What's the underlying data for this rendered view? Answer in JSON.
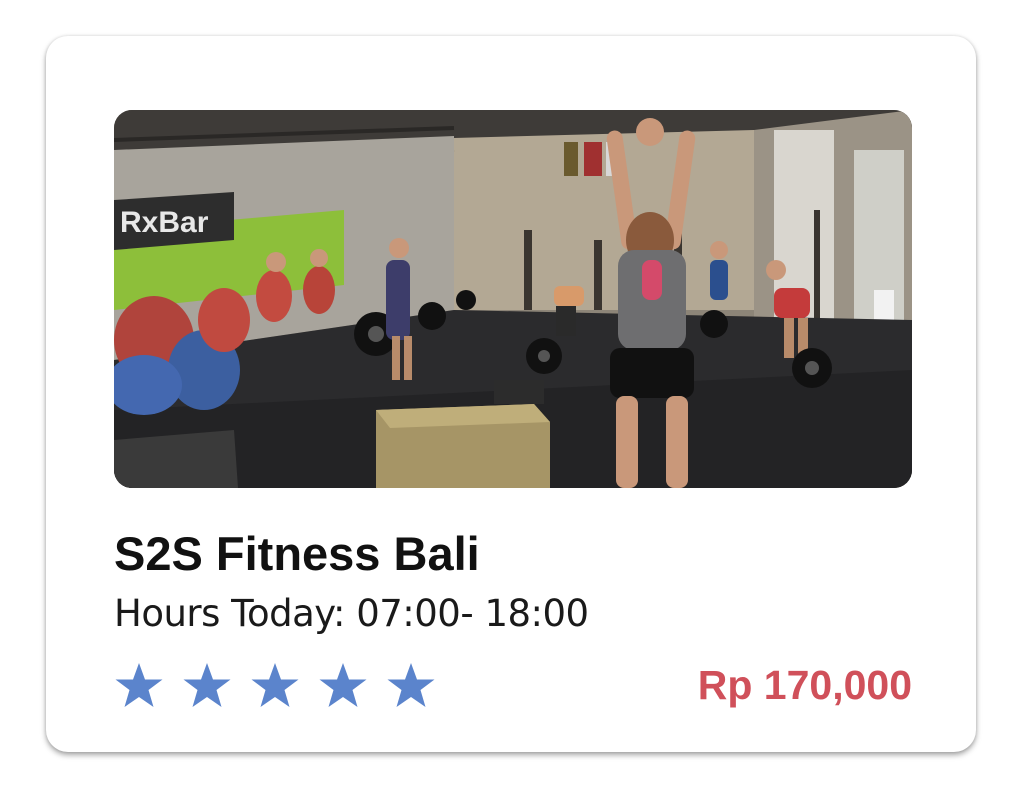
{
  "card": {
    "title": "S2S Fitness Bali",
    "hours": "Hours Today: 07:00- 18:00",
    "price": "Rp 170,000",
    "rating": 5,
    "rating_max": 5,
    "star_color": "#5b84cc",
    "price_color": "#d0505a",
    "photo": {
      "icon": "gym-photo",
      "banner_text": "RxBar"
    }
  }
}
